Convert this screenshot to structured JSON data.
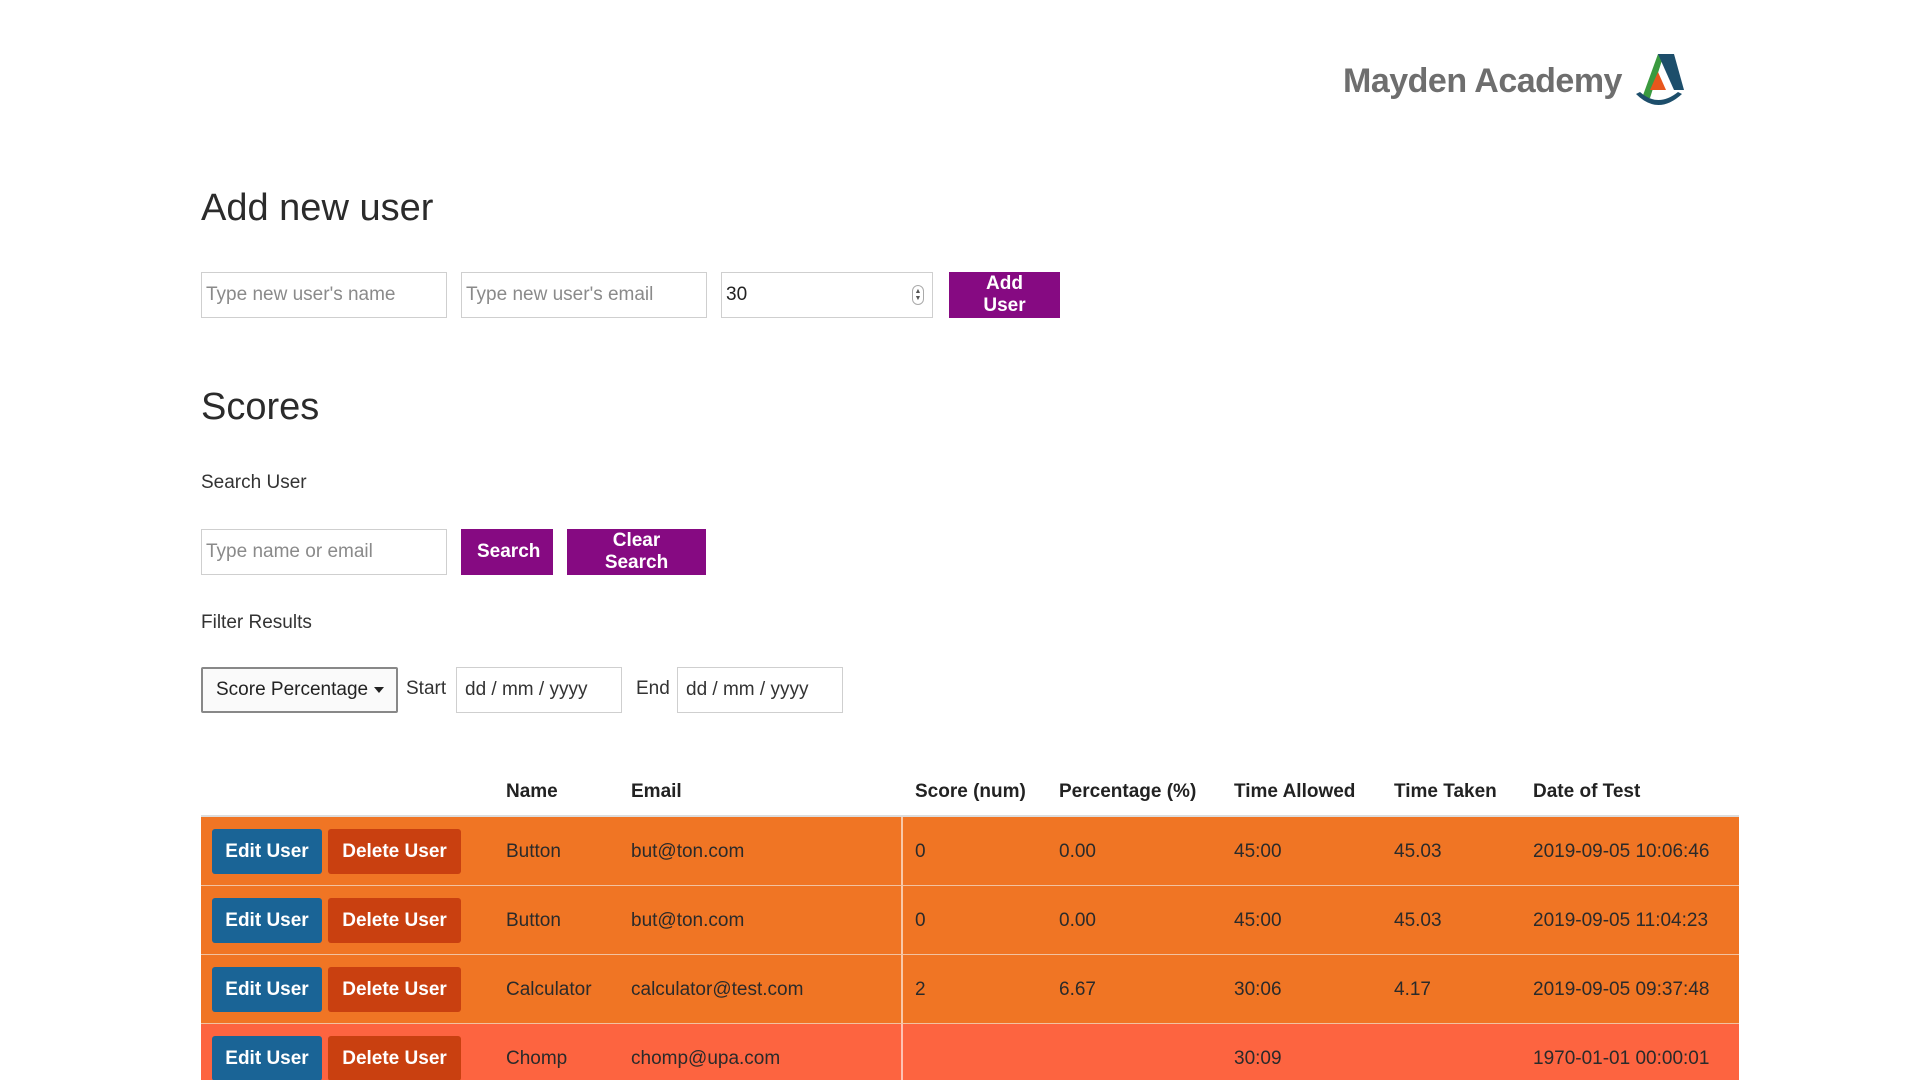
{
  "brand": {
    "name": "Mayden Academy",
    "logo_icon": "letter-a-logo-icon",
    "colors": {
      "gray": "#6e6e6e",
      "green": "#3a9a3f",
      "navy": "#1d4e6b",
      "orange": "#e8561c"
    }
  },
  "add_user": {
    "title": "Add new user",
    "name_placeholder": "Type new user's name",
    "email_placeholder": "Type new user's email",
    "time_value": "30",
    "add_button": "Add User"
  },
  "scores": {
    "title": "Scores",
    "search_label": "Search User",
    "search_placeholder": "Type name or email",
    "search_button": "Search",
    "clear_button": "Clear Search",
    "filter_label": "Filter Results",
    "filter_select": "Score Percentage",
    "start_label": "Start",
    "start_placeholder": "dd / mm / yyyy",
    "end_label": "End",
    "end_placeholder": "dd / mm / yyyy"
  },
  "table": {
    "headers": [
      "Name",
      "Email",
      "Score (num)",
      "Percentage (%)",
      "Time Allowed",
      "Time Taken",
      "Date of Test"
    ],
    "edit_label": "Edit User",
    "delete_label": "Delete User",
    "rows": [
      {
        "name": "Button",
        "email": "but@ton.com",
        "score": "0",
        "percentage": "0.00",
        "time_allowed": "45:00",
        "time_taken": "45.03",
        "date": "2019-09-05 10:06:46",
        "status": "orange"
      },
      {
        "name": "Button",
        "email": "but@ton.com",
        "score": "0",
        "percentage": "0.00",
        "time_allowed": "45:00",
        "time_taken": "45.03",
        "date": "2019-09-05 11:04:23",
        "status": "orange"
      },
      {
        "name": "Calculator",
        "email": "calculator@test.com",
        "score": "2",
        "percentage": "6.67",
        "time_allowed": "30:06",
        "time_taken": "4.17",
        "date": "2019-09-05 09:37:48",
        "status": "orange"
      },
      {
        "name": "Chomp",
        "email": "chomp@upa.com",
        "score": "",
        "percentage": "",
        "time_allowed": "30:09",
        "time_taken": "",
        "date": "1970-01-01 00:00:01",
        "status": "red"
      }
    ],
    "row_colors": {
      "orange": "#f07524",
      "red": "#fd6440"
    }
  }
}
